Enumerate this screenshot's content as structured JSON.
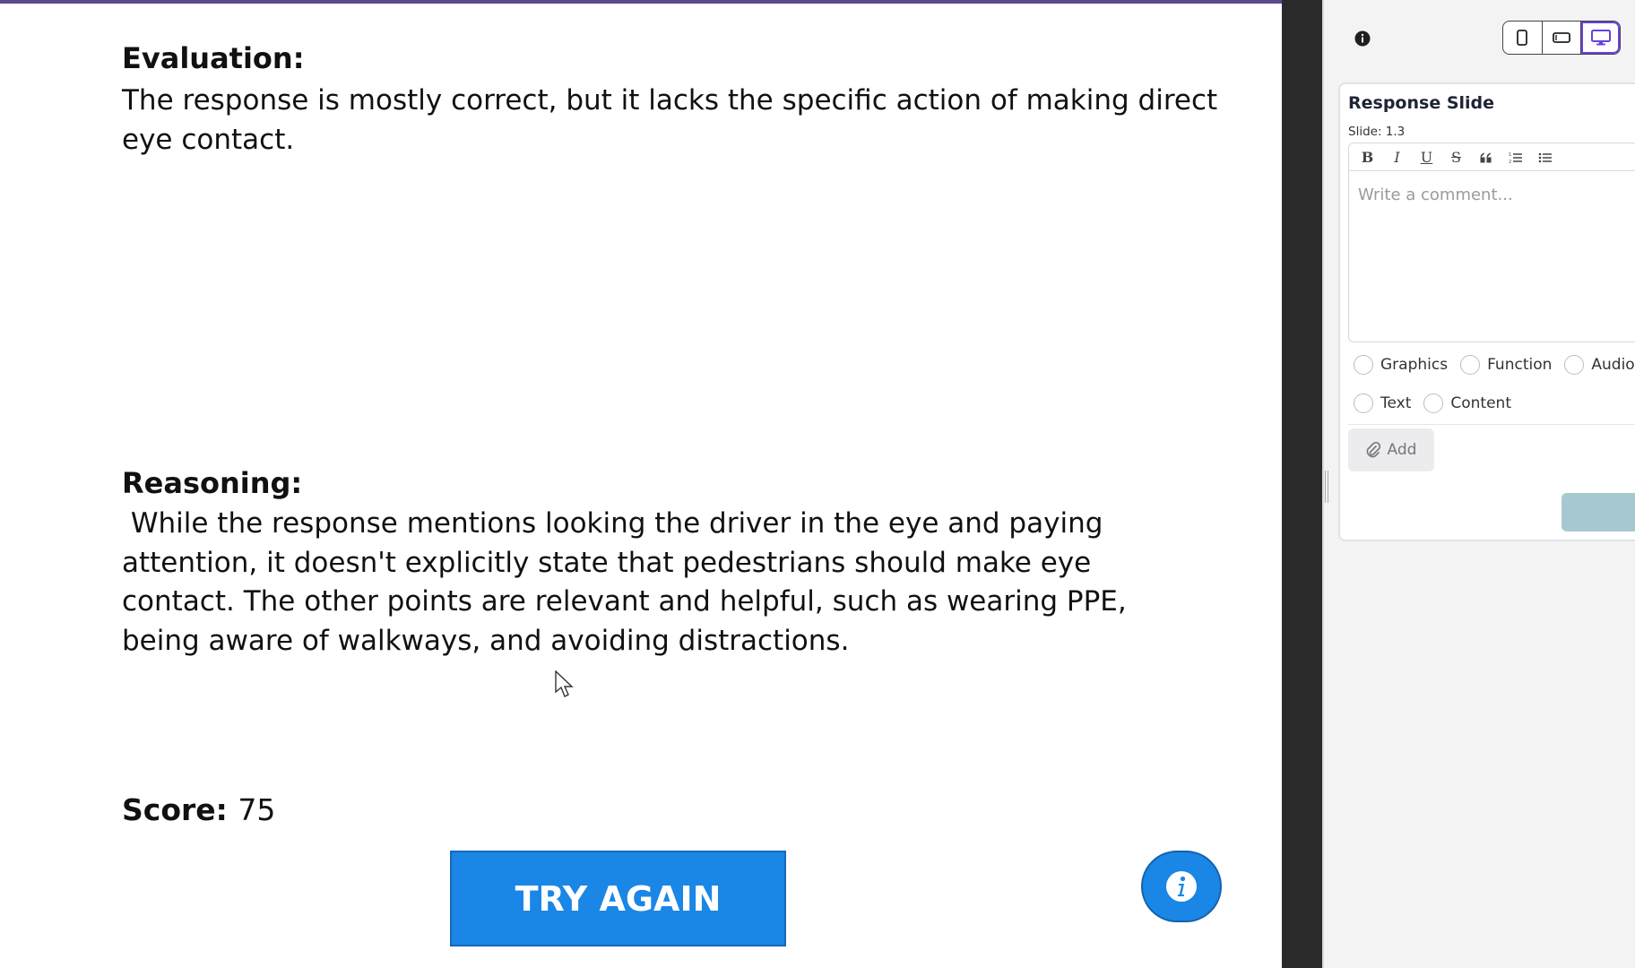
{
  "slide": {
    "evaluation_heading": "Evaluation:",
    "evaluation_text": "The response is mostly correct, but it lacks the specific action of making direct eye contact.",
    "reasoning_heading": "Reasoning:",
    "reasoning_text": " While the response mentions looking the driver in the eye and paying attention, it doesn't explicitly state that pedestrians should make eye contact. The other points are relevant and helpful, such as wearing PPE, being aware of walkways, and avoiding distractions.",
    "score_label": "Score:",
    "score_value": "75",
    "try_again_label": "TRY AGAIN",
    "info_icon": "info-icon",
    "accent_color": "#1a86e6"
  },
  "panel": {
    "device_buttons": [
      "phone-icon",
      "tablet-icon",
      "desktop-icon"
    ],
    "active_device": "desktop-icon",
    "card_title": "Response Slide",
    "card_subtitle": "Slide: 1.3",
    "toolbar": [
      "B",
      "I",
      "U",
      "S",
      "99",
      "ordered-list-icon",
      "bullet-list-icon"
    ],
    "comment_placeholder": "Write a comment...",
    "categories_row1": [
      "Graphics",
      "Function",
      "Audio"
    ],
    "categories_row2": [
      "Text",
      "Content"
    ],
    "add_label": "Add",
    "accent_color": "#6a3fe0"
  }
}
